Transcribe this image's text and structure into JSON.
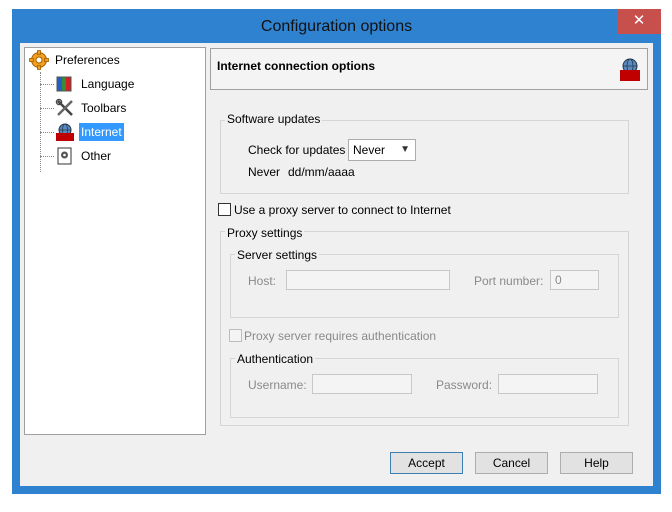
{
  "window": {
    "title": "Configuration options",
    "close_glyph": "✕"
  },
  "tree": {
    "items": [
      {
        "label": "Preferences",
        "icon": "gear-cog-icon"
      },
      {
        "label": "Language",
        "icon": "language-flag-icon"
      },
      {
        "label": "Toolbars",
        "icon": "tools-icon"
      },
      {
        "label": "Internet",
        "icon": "internet-globe-icon",
        "selected": true
      },
      {
        "label": "Other",
        "icon": "document-gear-icon"
      }
    ]
  },
  "header": {
    "title": "Internet connection options",
    "logo_icon": "internet-globe-icon"
  },
  "software_updates": {
    "group_title": "Software updates",
    "check_label": "Check for updates",
    "check_value": "Never",
    "last_label": "Never",
    "last_value": "dd/mm/aaaa"
  },
  "proxy": {
    "use_proxy_label": "Use a proxy server to connect to Internet",
    "use_proxy_checked": false,
    "group_title": "Proxy settings",
    "server_group_title": "Server settings",
    "host_label": "Host:",
    "host_value": "",
    "port_label": "Port number:",
    "port_value": "0",
    "auth_required_label": "Proxy server requires authentication",
    "auth_required_checked": false,
    "auth_group_title": "Authentication",
    "username_label": "Username:",
    "username_value": "",
    "password_label": "Password:",
    "password_value": ""
  },
  "buttons": {
    "accept": "Accept",
    "cancel": "Cancel",
    "help": "Help"
  },
  "colors": {
    "window_frame": "#2e82d0",
    "selection": "#3399ff",
    "close": "#c7504c"
  }
}
